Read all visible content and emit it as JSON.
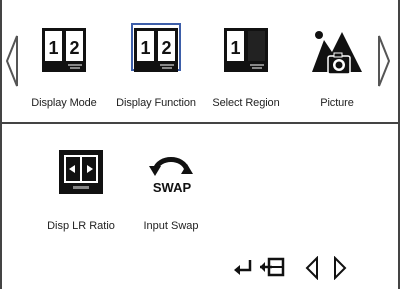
{
  "top_menu": {
    "items": [
      {
        "label": "Display Mode",
        "icon": "split-screen-icon"
      },
      {
        "label": "Display Function",
        "icon": "split-screen-icon"
      },
      {
        "label": "Select Region",
        "icon": "select-region-icon"
      },
      {
        "label": "Picture",
        "icon": "picture-icon"
      }
    ],
    "selected_index": 1,
    "left_arrow_icon": "chevron-left-icon",
    "right_arrow_icon": "chevron-right-icon"
  },
  "sub_menu": {
    "items": [
      {
        "label": "Disp LR Ratio",
        "icon": "lr-ratio-icon"
      },
      {
        "label": "Input Swap",
        "icon": "swap-icon",
        "icon_text": "SWAP"
      }
    ]
  },
  "nav": {
    "icons": [
      "enter-icon",
      "exit-icon",
      "nav-left-icon",
      "nav-right-icon"
    ]
  },
  "colors": {
    "selection": "#3d5ea9",
    "frame": "#444444",
    "icon": "#111111"
  },
  "monitor_icon_text": {
    "one": "1",
    "two": "2"
  }
}
